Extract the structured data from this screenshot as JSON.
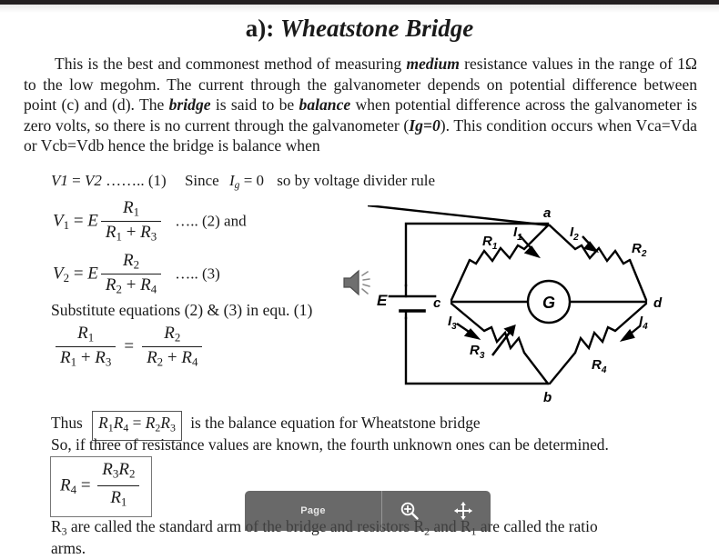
{
  "slide": {
    "title_prefix": "a): ",
    "title": "Wheatstone Bridge"
  },
  "paragraph": {
    "t1": "This is the best and commonest method of measuring ",
    "b1": "medium",
    "t2": " resistance values in the range of 1Ω to the low megohm. The current through the galvanometer depends on potential difference between point (c) and (d). The ",
    "b2": "bridge",
    "t3": " is said to be ",
    "b3": "balance",
    "t4": " when potential difference across the galvanometer is zero volts, so there is no current through the galvanometer (",
    "b4": "Ig=0",
    "t5": "). This condition occurs when  Vca=Vda      or      Vcb=Vdb   hence the bridge is balance when"
  },
  "equations": {
    "line1": {
      "lhs_v1": "V",
      "lhs_1": "1",
      "eq": " = ",
      "rhs_v2": "V",
      "rhs_2": "2",
      "dots": "  …….. (1)",
      "since": "Since",
      "i": "I",
      "g": "g",
      "zero": " = 0",
      "tail": "so by voltage divider rule"
    },
    "eq2": {
      "v": "V",
      "vsub": "1",
      "eq": " = ",
      "e": "E",
      "num": "R",
      "numsub": "1",
      "den_a": "R",
      "den_asub": "1",
      "plus": " + ",
      "den_b": "R",
      "den_bsub": "3",
      "tag": "….. (2) and"
    },
    "eq3": {
      "v": "V",
      "vsub": "2",
      "eq": " = ",
      "e": "E",
      "num": "R",
      "numsub": "2",
      "den_a": "R",
      "den_asub": "2",
      "plus": " + ",
      "den_b": "R",
      "den_bsub": "4",
      "tag": "….. (3)"
    },
    "substitute": "Substitute equations (2) & (3) in equ. (1)",
    "eq4": {
      "lnum": "R",
      "lnumsub": "1",
      "lden_a": "R",
      "lden_asub": "1",
      "lplus": " + ",
      "lden_b": "R",
      "lden_bsub": "3",
      "eq": "=",
      "rnum": "R",
      "rnumsub": "2",
      "rden_a": "R",
      "rden_asub": "2",
      "rplus": " + ",
      "rden_b": "R",
      "rden_bsub": "4"
    }
  },
  "bottom": {
    "thus": "Thus",
    "balance_eq": {
      "r1": "R",
      "r1s": "1",
      "r4": "R",
      "r4s": "4",
      "eq": " = ",
      "r2": "R",
      "r2s": "2",
      "r3": "R",
      "r3s": "3"
    },
    "balance_tail": "is the balance equation for Wheatstone bridge",
    "known_line": "So, if three of resistance values are known, the fourth unknown ones can be determined.",
    "r4_formula": {
      "lhs": "R",
      "lhs_sub": "4",
      "eq": " = ",
      "num_a": "R",
      "num_asub": "3",
      "num_b": "R",
      "num_bsub": "2",
      "den": "R",
      "den_sub": "1"
    },
    "last_line_a": "R",
    "last_line_a_sub": "3",
    "last_line_b": " are called the standard arm of the bridge and resistors R",
    "last_line_b_sub": "2",
    "last_line_c": " and R",
    "last_line_c_sub": "1",
    "last_line_d": " are called the ratio",
    "last_line_e": "arms."
  },
  "circuit": {
    "node_a": "a",
    "node_b": "b",
    "node_c": "c",
    "node_d": "d",
    "source": "E",
    "galvanometer": "G",
    "r1": "R",
    "r1_sub": "1",
    "r2": "R",
    "r2_sub": "2",
    "r3": "R",
    "r3_sub": "3",
    "r4": "R",
    "r4_sub": "4",
    "i1": "I",
    "i1_sub": "1",
    "i2": "I",
    "i2_sub": "2",
    "i3": "I",
    "i3_sub": "3",
    "i4": "I",
    "i4_sub": "4"
  },
  "toolbar": {
    "page_label": "Page",
    "zoom_icon": "magnifier-plus-icon",
    "fullscreen_icon": "fullscreen-expand-icon",
    "background_color": "#484848"
  },
  "media": {
    "speaker_icon": "speaker-sound-icon"
  }
}
